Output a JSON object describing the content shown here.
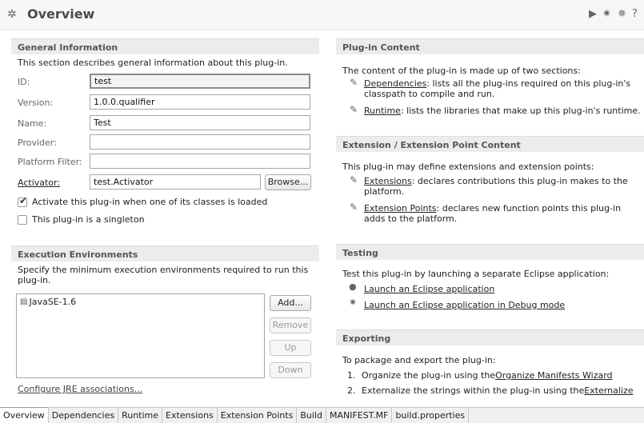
{
  "header": {
    "title": "Overview",
    "icons": [
      "plugin-icon",
      "run-icon",
      "debug-icon",
      "debug-alt-icon",
      "help-icon"
    ]
  },
  "general": {
    "title": "General Information",
    "description": "This section describes general information about this plug-in.",
    "id_label": "ID:",
    "id_value": "test",
    "version_label": "Version:",
    "version_value": "1.0.0.qualifier",
    "name_label": "Name:",
    "name_value": "Test",
    "provider_label": "Provider:",
    "provider_value": "",
    "platform_filter_label": "Platform Filter:",
    "platform_filter_value": "",
    "activator_label": "Activator:",
    "activator_value": "test.Activator",
    "browse_label": "Browse...",
    "activate_checkbox_label": "Activate this plug-in when one of its classes is loaded",
    "activate_checked": true,
    "singleton_checkbox_label": "This plug-in is a singleton",
    "singleton_checked": false
  },
  "execution": {
    "title": "Execution Environments",
    "description": "Specify the minimum execution environments required to run this plug-in.",
    "items": [
      "JavaSE-1.6"
    ],
    "add_label": "Add...",
    "remove_label": "Remove",
    "up_label": "Up",
    "down_label": "Down",
    "configure_link": "Configure JRE associations..."
  },
  "plugin_content": {
    "title": "Plug-in Content",
    "intro": "The content of the plug-in is made up of two sections:",
    "dependencies_link": "Dependencies",
    "dependencies_text_1": ": lists all the plug-ins required on this plug-in's",
    "dependencies_text_2": "classpath to compile and run.",
    "runtime_link": "Runtime",
    "runtime_text": ": lists the libraries that make up this plug-in's runtime."
  },
  "extension_content": {
    "title": "Extension / Extension Point Content",
    "intro": "This plug-in may define extensions and extension points:",
    "extensions_link": "Extensions",
    "extensions_text_1": ": declares contributions this plug-in makes to the",
    "extensions_text_2": "platform.",
    "extension_points_link": "Extension Points",
    "extension_points_text_1": ": declares new function points this plug-in",
    "extension_points_text_2": "adds to the platform."
  },
  "testing": {
    "title": "Testing",
    "intro": "Test this plug-in by launching a separate Eclipse application:",
    "launch_link": "Launch an Eclipse application",
    "debug_link": "Launch an Eclipse application in Debug mode"
  },
  "exporting": {
    "title": "Exporting",
    "intro": "To package and export the plug-in:",
    "step1_prefix": "1.",
    "step1_text": "Organize the plug-in using the",
    "step1_link": "Organize Manifests Wizard",
    "step2_prefix": "2.",
    "step2_text": "Externalize the strings within the plug-in using the",
    "step2_link": "Externalize"
  },
  "tabs": [
    "Overview",
    "Dependencies",
    "Runtime",
    "Extensions",
    "Extension Points",
    "Build",
    "MANIFEST.MF",
    "build.properties"
  ],
  "active_tab": "Overview"
}
